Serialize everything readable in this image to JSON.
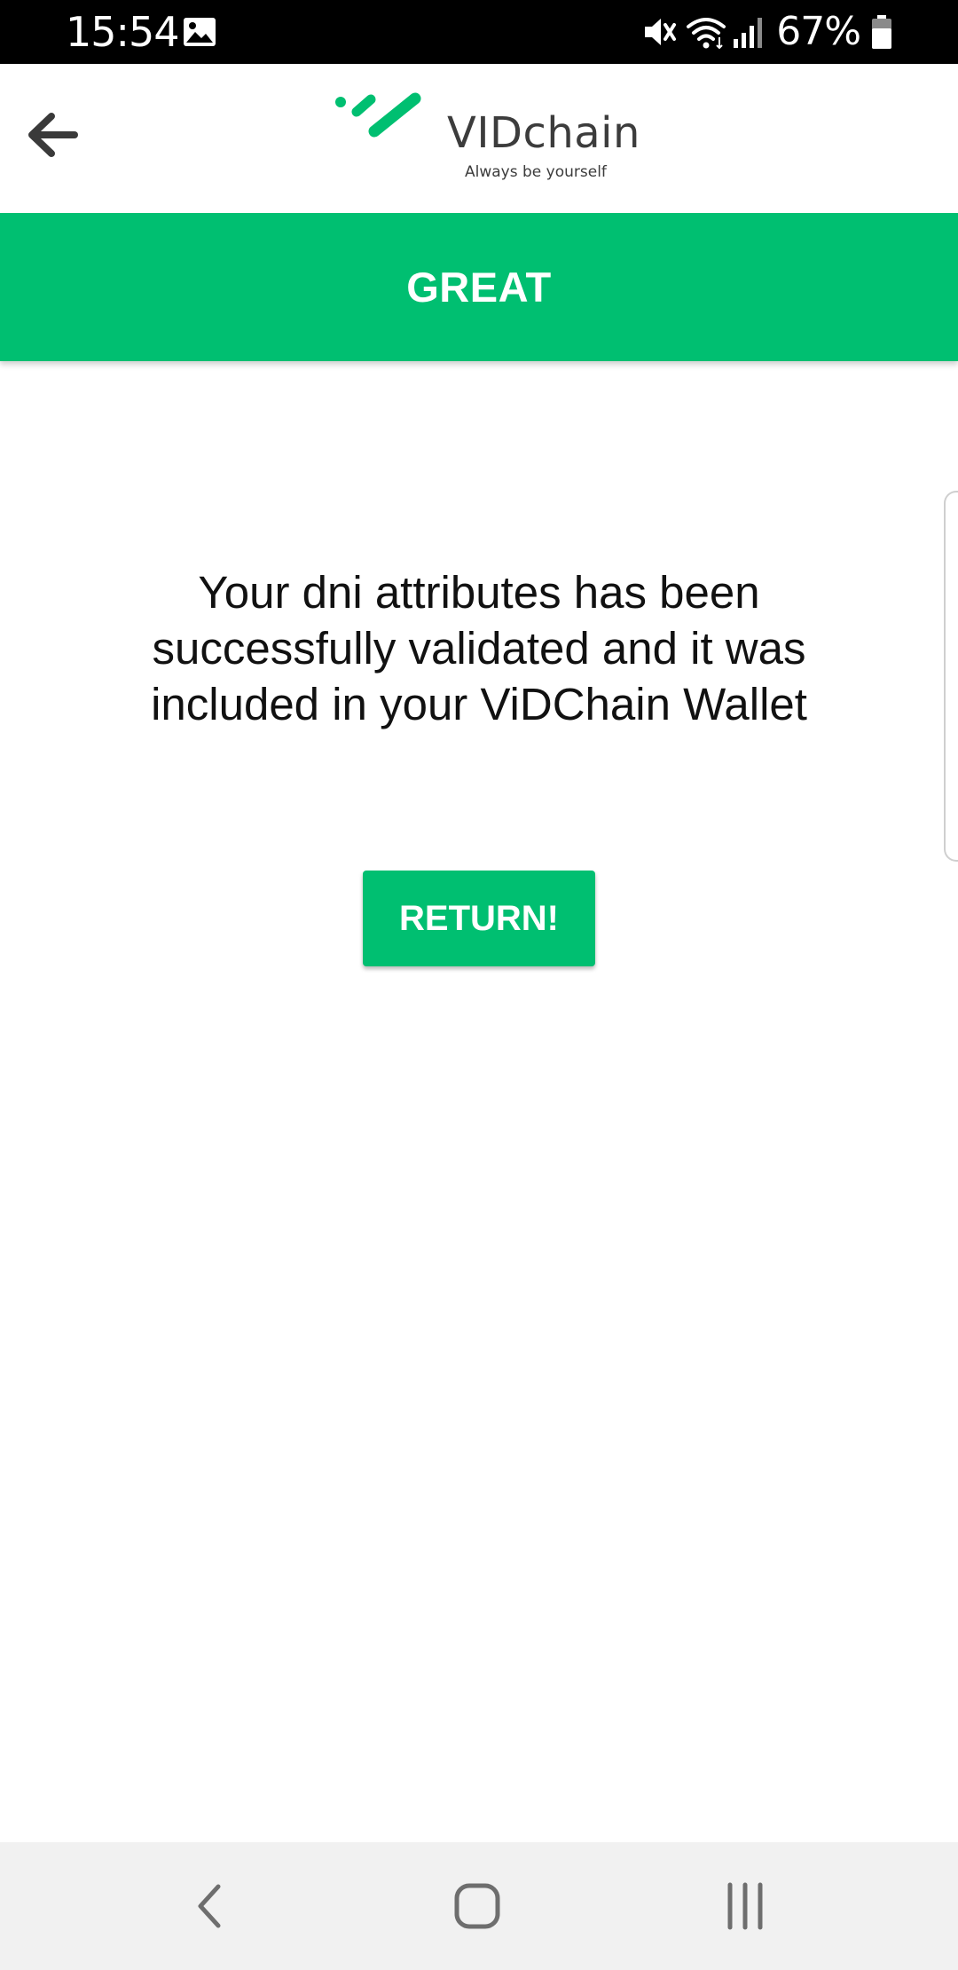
{
  "status_bar": {
    "time": "15:54",
    "battery_percent": "67%",
    "icons": [
      "gallery-icon",
      "mute-icon",
      "wifi-icon",
      "signal-icon",
      "battery-icon"
    ]
  },
  "header": {
    "back_icon": "arrow-left-icon",
    "logo_name": "VIDchain",
    "logo_tagline": "Always be yourself"
  },
  "banner": {
    "title": "GREAT"
  },
  "main": {
    "message": "Your dni attributes has been successfully validated and it was included in your ViDChain Wallet",
    "return_button_label": "RETURN!"
  },
  "nav_bar": {
    "icons": [
      "back-chevron-icon",
      "home-icon",
      "recents-icon"
    ]
  },
  "colors": {
    "accent": "#00bf71",
    "status_bar": "#000000",
    "nav_bar": "#f1f1f1",
    "text": "#111111"
  }
}
